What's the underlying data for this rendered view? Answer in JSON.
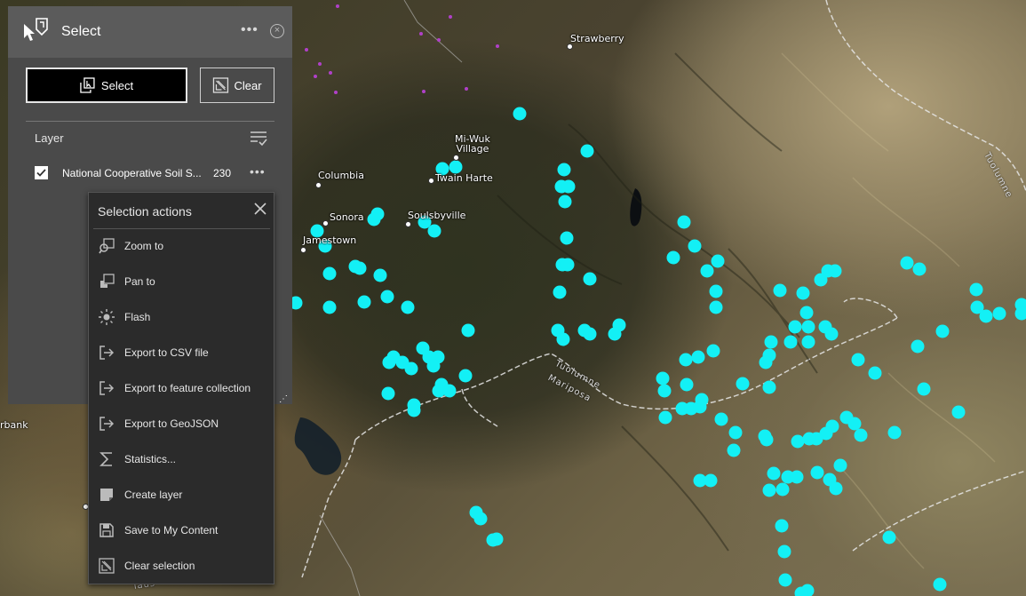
{
  "widget": {
    "title": "Select",
    "icon": "select-cursor-icon",
    "more_glyph": "•••",
    "close_glyph": "×",
    "select_label": "Select",
    "clear_label": "Clear",
    "layer_heading": "Layer",
    "layer": {
      "name": "National Cooperative Soil S...",
      "count": "230",
      "checked": true,
      "more_glyph": "•••"
    }
  },
  "actions_menu": {
    "title": "Selection actions",
    "items": [
      {
        "label": "Zoom to",
        "icon": "zoom-to-icon"
      },
      {
        "label": "Pan to",
        "icon": "pan-to-icon"
      },
      {
        "label": "Flash",
        "icon": "flash-icon"
      },
      {
        "label": "Export to CSV file",
        "icon": "export-icon"
      },
      {
        "label": "Export to feature collection",
        "icon": "export-icon"
      },
      {
        "label": "Export to GeoJSON",
        "icon": "export-icon"
      },
      {
        "label": "Statistics...",
        "icon": "sigma-icon"
      },
      {
        "label": "Create layer",
        "icon": "create-layer-icon"
      },
      {
        "label": "Save to My Content",
        "icon": "save-icon"
      },
      {
        "label": "Clear selection",
        "icon": "clear-selection-icon"
      }
    ]
  },
  "map": {
    "places": {
      "strawberry": "Strawberry",
      "miwuk_line1": "Mi-Wuk",
      "miwuk_line2": "Village",
      "columbia": "Columbia",
      "twain_harte": "Twain Harte",
      "sonora": "Sonora",
      "soulsbyville": "Soulsbyville",
      "jamestown": "Jamestown",
      "bank": "rbank",
      "tuolumne_river": "Tuolumne",
      "mariposa": "Mariposa",
      "tuolumne_ne": "Tuolumne",
      "laus": "laus"
    },
    "feature_color": "#13f0f5",
    "points_color": "#b040c8"
  }
}
